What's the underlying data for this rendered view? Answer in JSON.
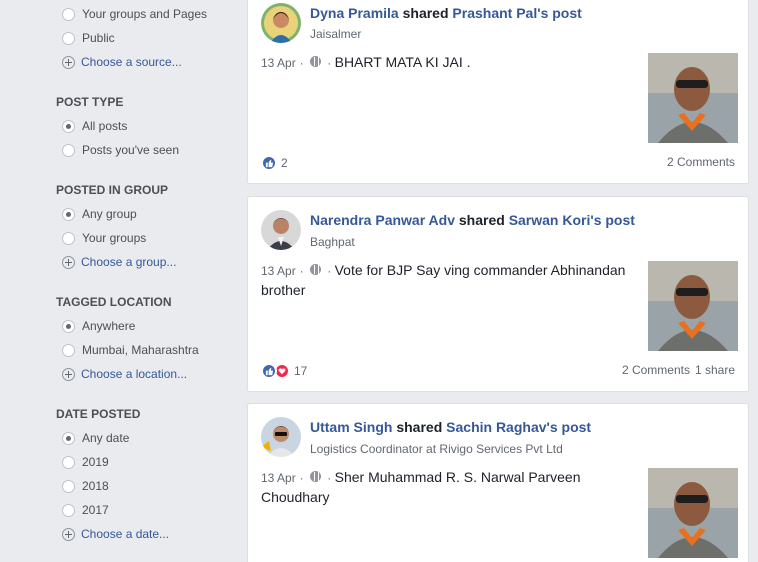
{
  "filters": {
    "source": {
      "options": [
        "Your groups and Pages",
        "Public"
      ],
      "choose": "Choose a source..."
    },
    "post_type": {
      "title": "POST TYPE",
      "options": [
        "All posts",
        "Posts you've seen"
      ]
    },
    "posted_in_group": {
      "title": "POSTED IN GROUP",
      "options": [
        "Any group",
        "Your groups"
      ],
      "choose": "Choose a group..."
    },
    "tagged_location": {
      "title": "TAGGED LOCATION",
      "options": [
        "Anywhere",
        "Mumbai, Maharashtra"
      ],
      "choose": "Choose a location..."
    },
    "date_posted": {
      "title": "DATE POSTED",
      "options": [
        "Any date",
        "2019",
        "2018",
        "2017"
      ],
      "choose": "Choose a date..."
    }
  },
  "posts": [
    {
      "author": "Dyna Pramila",
      "action": "shared",
      "source": "Prashant Pal's post",
      "subtitle": "Jaisalmer",
      "date": "13 Apr",
      "text": "BHART MATA KI JAI .",
      "reaction_count": "2",
      "comments": "2 Comments",
      "shares": ""
    },
    {
      "author": "Narendra Panwar Adv",
      "action": "shared",
      "source": "Sarwan Kori's post",
      "subtitle": "Baghpat",
      "date": "13 Apr",
      "text": "Vote for BJP Say ving commander Abhinandan brother",
      "reaction_count": "17",
      "comments": "2 Comments",
      "shares": "1 share"
    },
    {
      "author": "Uttam Singh",
      "action": "shared",
      "source": "Sachin Raghav's post",
      "subtitle": "Logistics Coordinator at Rivigo Services Pvt Ltd",
      "date": "13 Apr",
      "text": "Sher Muhammad R. S. Narwal Parveen Choudhary",
      "reaction_count": "",
      "comments": "",
      "shares": ""
    }
  ],
  "colors": {
    "link": "#365899",
    "like": "#4267b2",
    "love": "#f0284a",
    "background": "#e9ebee"
  }
}
